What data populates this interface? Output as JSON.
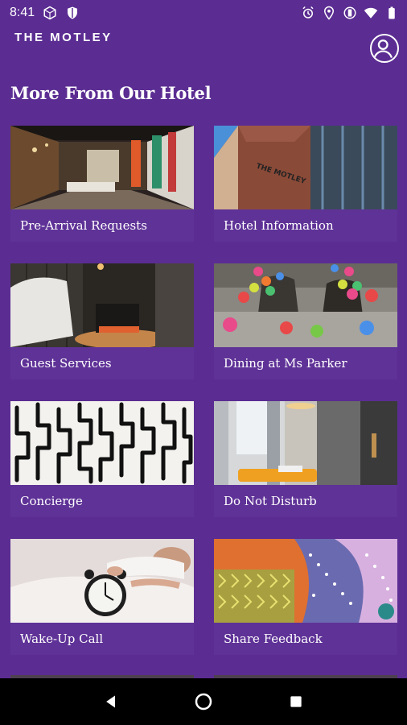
{
  "status_bar": {
    "time": "8:41",
    "left_icons": [
      "cube-icon",
      "shield-icon"
    ],
    "right_icons": [
      "alarm-icon",
      "location-icon",
      "vibrate-icon",
      "wifi-icon",
      "battery-icon"
    ]
  },
  "header": {
    "brand": "THE MOTLEY",
    "profile_icon": "account-circle-icon"
  },
  "main": {
    "title": "More From Our Hotel",
    "cards": [
      {
        "label": "Pre-Arrival Requests",
        "image": "hotel-lobby"
      },
      {
        "label": "Hotel Information",
        "image": "hotel-facade"
      },
      {
        "label": "Guest Services",
        "image": "bedroom-nightstand"
      },
      {
        "label": "Dining at Ms Parker",
        "image": "balloon-collage"
      },
      {
        "label": "Concierge",
        "image": "maze-pattern"
      },
      {
        "label": "Do Not Disturb",
        "image": "hotel-room"
      },
      {
        "label": "Wake-Up Call",
        "image": "alarm-clock"
      },
      {
        "label": "Share Feedback",
        "image": "patterned-fabric"
      }
    ]
  },
  "nav_bar": {
    "buttons": [
      "back-icon",
      "home-icon",
      "recents-icon"
    ]
  },
  "colors": {
    "background": "#5b2d92",
    "card": "#5f3297",
    "text": "#ffffff"
  }
}
